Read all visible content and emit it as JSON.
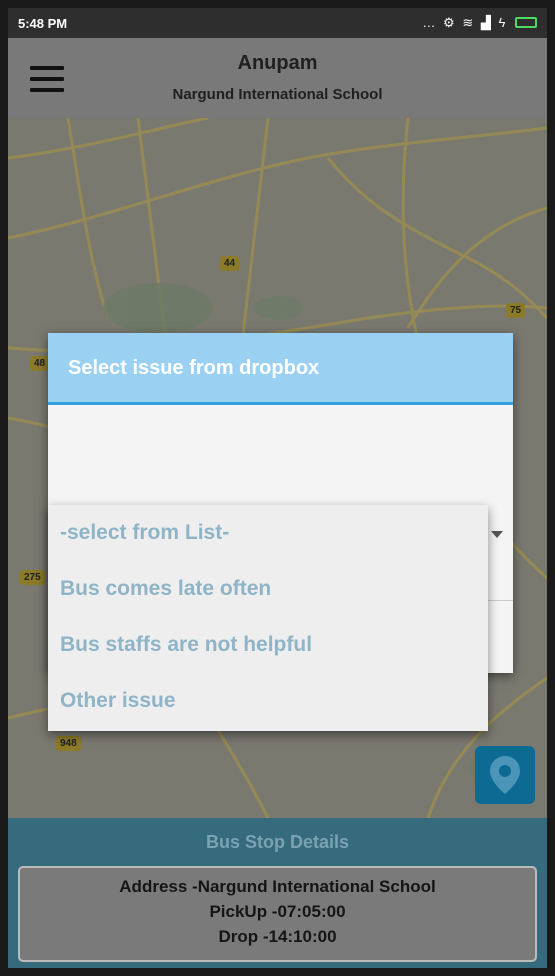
{
  "status_bar": {
    "time": "5:48 PM",
    "icons": [
      "more-icon",
      "alarm-icon",
      "wifi-icon",
      "signal-icon",
      "charging-icon",
      "battery-icon"
    ]
  },
  "header": {
    "menu_icon": "hamburger-icon",
    "title": "Anupam",
    "subtitle": "Nargund International School"
  },
  "map": {
    "road_labels": [
      "44",
      "75",
      "48",
      "275",
      "948"
    ]
  },
  "dialog": {
    "title": "Select issue from dropbox",
    "spinner_icon": "dropdown-arrow-icon"
  },
  "dropdown": {
    "options": [
      "-select from List-",
      "Bus comes late often",
      "Bus staffs are not helpful",
      "Other issue"
    ]
  },
  "bus_stop": {
    "header": "Bus Stop Details",
    "address": "Address -Nargund International School",
    "pickup": "PickUp -07:05:00",
    "drop": "Drop -14:10:00"
  },
  "colors": {
    "dialog_header": "#9ad1f3",
    "dialog_accent": "#35a2e0",
    "dropdown_text": "#8fb4c7",
    "location_button": "#0d6a92",
    "bus_stop_bg": "#366b7e"
  }
}
